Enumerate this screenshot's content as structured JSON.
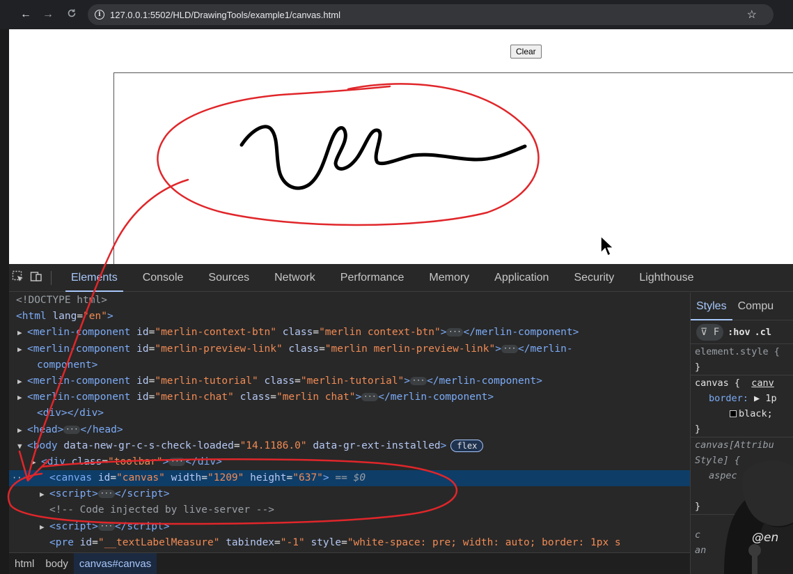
{
  "browser": {
    "url": "127.0.0.1:5502/HLD/DrawingTools/example1/canvas.html",
    "back_icon": "←",
    "forward_icon": "→",
    "reload_icon": "C",
    "info_icon": "i",
    "star_icon": "☆"
  },
  "page": {
    "clear_label": "Clear"
  },
  "devtools": {
    "tabs": [
      "Elements",
      "Console",
      "Sources",
      "Network",
      "Performance",
      "Memory",
      "Application",
      "Security",
      "Lighthouse"
    ],
    "active_tab": "Elements",
    "dom": {
      "doctype": "<!DOCTYPE html>",
      "html_open": "<html",
      "html_attr": "lang",
      "html_val": "\"en\"",
      "mc1_id": "\"merlin-context-btn\"",
      "mc1_class": "\"merlin context-btn\"",
      "mc2_id": "\"merlin-preview-link\"",
      "mc2_class": "\"merlin merlin-preview-link\"",
      "mc2_tail": "component>",
      "mc3_id": "\"merlin-tutorial\"",
      "mc3_class": "\"merlin-tutorial\"",
      "mc4_id": "\"merlin-chat\"",
      "mc4_class": "\"merlin chat\"",
      "div_empty": "<div></div>",
      "head": "<head>",
      "head_close": "</head>",
      "body_attr1": "data-new-gr-c-s-check-loaded",
      "body_val1": "\"14.1186.0\"",
      "body_attr2": "data-gr-ext-installed",
      "flex_badge": "flex",
      "toolbar_class": "\"toolbar\"",
      "canvas_id": "\"canvas\"",
      "canvas_width": "\"1209\"",
      "canvas_height": "\"637\"",
      "dollar": "$0",
      "comment": "<!-- Code injected by live-server -->",
      "pre_id": "\"__textLabelMeasure\"",
      "pre_tabindex": "\"-1\"",
      "pre_style": "\"white-space: pre; width: auto; border: 1px s"
    },
    "breadcrumbs": [
      "html",
      "body",
      "canvas#canvas"
    ],
    "styles": {
      "tabs": [
        "Styles",
        "Compu"
      ],
      "filter_label": "F",
      "hov": ":hov",
      "cls": ".cl",
      "element_style": "element.style {",
      "close_brace": "}",
      "canvas_rule": "canvas {",
      "canvas_source": "canv",
      "border_prop": "border:",
      "border_val": "1p",
      "border_color": "black;",
      "ua_rule": "canvas[Attribu",
      "ua_rule2": "Style] {",
      "aspect": "aspec",
      "c_line": "c",
      "an_line": "an"
    }
  },
  "watermark": "@en",
  "colors": {
    "annotation_red": "#e0262a",
    "selected_row": "#0e3d68",
    "accent": "#a8c7fa"
  }
}
